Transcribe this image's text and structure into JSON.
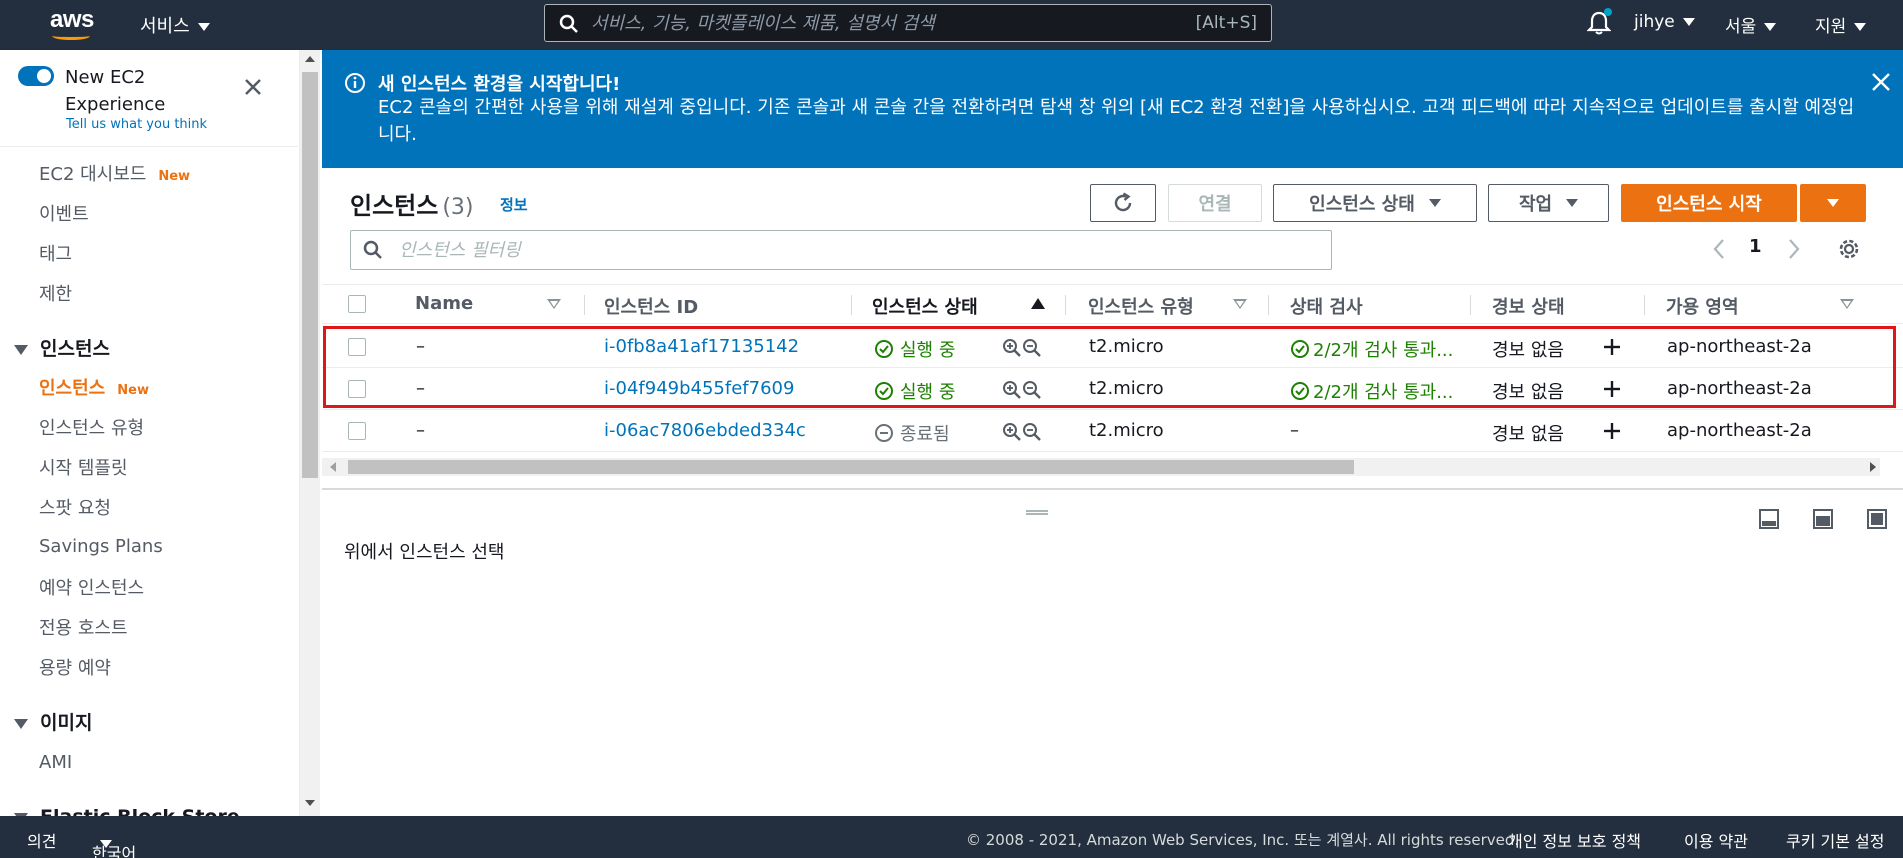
{
  "topnav": {
    "logo_text": "aws",
    "services_label": "서비스",
    "search_placeholder": "서비스, 기능, 마켓플레이스 제품, 설명서 검색",
    "search_shortcut": "[Alt+S]",
    "user": "jihye",
    "region": "서울",
    "support": "지원"
  },
  "sidebar": {
    "experience_title": "New EC2 Experience",
    "experience_link": "Tell us what you think",
    "new_badge": "New",
    "items_top": [
      "EC2 대시보드",
      "이벤트",
      "태그",
      "제한"
    ],
    "group_instances": "인스턴스",
    "items_instances": [
      "인스턴스",
      "인스턴스 유형",
      "시작 템플릿",
      "스팟 요청",
      "Savings Plans",
      "예약 인스턴스",
      "전용 호스트",
      "용량 예약"
    ],
    "group_images": "이미지",
    "items_images": [
      "AMI"
    ],
    "group_ebs": "Elastic Block Store"
  },
  "banner": {
    "title": "새 인스턴스 환경을 시작합니다!",
    "text": "EC2 콘솔의 간편한 사용을 위해 재설계 중입니다. 기존 콘솔과 새 콘솔 간을 전환하려면 탐색 창 위의 [새 EC2 환경 전환]을 사용하십시오. 고객 피드백에 따라 지속적으로 업데이트를 출시할 예정입니다."
  },
  "panel": {
    "title": "인스턴스",
    "count": "(3)",
    "info_link": "정보",
    "connect_label": "연결",
    "state_label": "인스턴스 상태",
    "actions_label": "작업",
    "launch_label": "인스턴스 시작",
    "filter_placeholder": "인스턴스 필터링",
    "page": "1"
  },
  "table": {
    "columns": [
      "Name",
      "인스턴스 ID",
      "인스턴스 상태",
      "인스턴스 유형",
      "상태 검사",
      "경보 상태",
      "가용 영역"
    ],
    "rows": [
      {
        "name": "–",
        "id": "i-0fb8a41af17135142",
        "state": "실행 중",
        "state_kind": "running",
        "type": "t2.micro",
        "check": "2/2개 검사 통과...",
        "alarm": "경보 없음",
        "az": "ap-northeast-2a"
      },
      {
        "name": "–",
        "id": "i-04f949b455fef7609",
        "state": "실행 중",
        "state_kind": "running",
        "type": "t2.micro",
        "check": "2/2개 검사 통과...",
        "alarm": "경보 없음",
        "az": "ap-northeast-2a"
      },
      {
        "name": "–",
        "id": "i-06ac7806ebded334c",
        "state": "종료됨",
        "state_kind": "terminated",
        "type": "t2.micro",
        "check": "–",
        "alarm": "경보 없음",
        "az": "ap-northeast-2a"
      }
    ]
  },
  "detail": {
    "empty_text": "위에서 인스턴스 선택"
  },
  "footer": {
    "feedback": "의견",
    "language": "한국어",
    "copyright": "© 2008 - 2021, Amazon Web Services, Inc. 또는 계열사. All rights reserved.",
    "privacy": "개인 정보 보호 정책",
    "terms": "이용 약관",
    "cookies": "쿠키 기본 설정"
  },
  "colors": {
    "nav_bg": "#232f3e",
    "banner_bg": "#0073bb",
    "primary": "#ec7211",
    "link": "#0073bb",
    "success": "#1d8102",
    "highlight": "#e0161b"
  }
}
